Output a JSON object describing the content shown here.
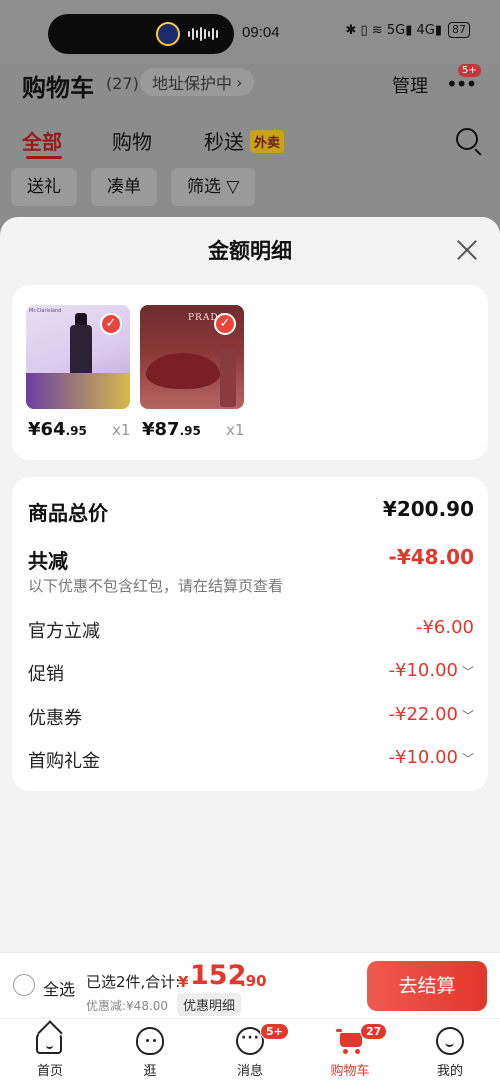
{
  "status_bar": {
    "time": "09:04",
    "indicators": "✱ ▯ ≋ 5G▮ 4G▮",
    "battery": "87"
  },
  "header": {
    "title": "购物车",
    "count": "(27)",
    "address": "地址保护中",
    "address_chevron": "›",
    "manage": "管理",
    "more": "•••",
    "more_badge": "5+"
  },
  "tabs": [
    {
      "label": "全部"
    },
    {
      "label": "购物"
    },
    {
      "label": "秒送"
    }
  ],
  "tab_tag": "外卖",
  "filters": [
    {
      "label": "送礼"
    },
    {
      "label": "凑单"
    },
    {
      "label": "筛选 ▽"
    }
  ],
  "sheet": {
    "title": "金额明细",
    "products": [
      {
        "brand": "Mr.Clarisland",
        "price_int": "¥64",
        "price_dec": ".95",
        "qty": "x1",
        "selected": true
      },
      {
        "brand": "PRADA",
        "price_int": "¥87",
        "price_dec": ".95",
        "qty": "x1",
        "selected": true
      }
    ],
    "summary": {
      "total_label": "商品总价",
      "total_value": "¥200.90",
      "reduce_label": "共减",
      "reduce_value": "-¥48.00",
      "note": "以下优惠不包含红包，请在结算页查看",
      "items": [
        {
          "label": "官方立减",
          "value": "-¥6.00",
          "chevron": ""
        },
        {
          "label": "促销",
          "value": "-¥10.00",
          "chevron": "﹀"
        },
        {
          "label": "优惠券",
          "value": "-¥22.00",
          "chevron": "﹀"
        },
        {
          "label": "首购礼金",
          "value": "-¥10.00",
          "chevron": "﹀"
        }
      ]
    }
  },
  "checkout": {
    "select_all": "全选",
    "selected_text": "已选2件,合计:",
    "currency": "¥",
    "total_int": "152",
    "total_dec": ".90",
    "discount_text": "优惠减:¥48.00",
    "detail_label": "优惠明细",
    "button": "去结算"
  },
  "bottom_nav": [
    {
      "label": "首页",
      "icon": "home-icon",
      "badge": ""
    },
    {
      "label": "逛",
      "icon": "browse-icon",
      "badge": ""
    },
    {
      "label": "消息",
      "icon": "message-icon",
      "badge": "5+"
    },
    {
      "label": "购物车",
      "icon": "cart-icon",
      "badge": "27"
    },
    {
      "label": "我的",
      "icon": "profile-icon",
      "badge": ""
    }
  ],
  "colors": {
    "accent": "#e2372b",
    "overlay": "#8c8c8c",
    "sheet_bg": "#f3f3f3"
  }
}
